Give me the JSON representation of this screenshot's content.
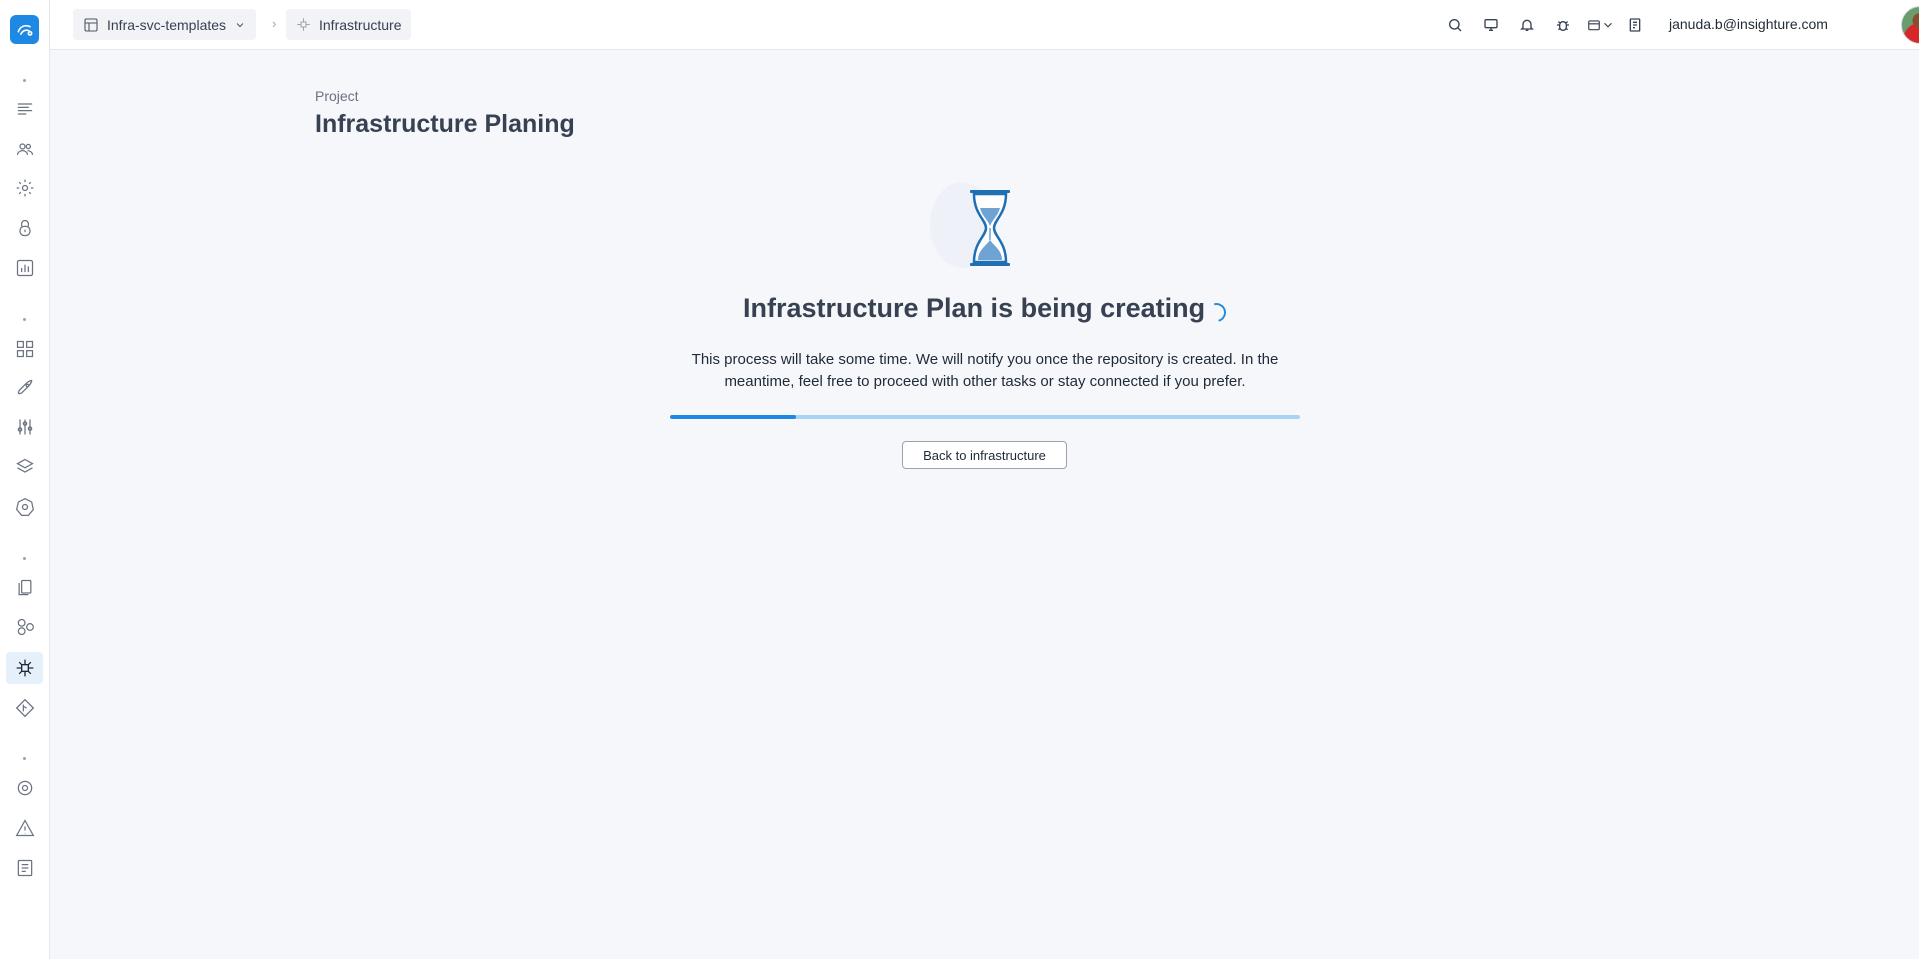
{
  "header": {
    "workspace": "Infra-svc-templates",
    "section": "Infrastructure",
    "user_email": "januda.b@insighture.com"
  },
  "sidebar": {
    "icons": [
      "menu-lines-icon",
      "users-icon",
      "gear-icon",
      "lock-icon",
      "bar-chart-icon",
      "dashboard-grid-icon",
      "rocket-icon",
      "sliders-icon",
      "layers-icon",
      "kubernetes-icon",
      "documents-icon",
      "circles-icon",
      "infrastructure-icon",
      "git-icon",
      "settings-cog-icon",
      "warning-icon",
      "notes-icon"
    ],
    "active": "infrastructure-icon"
  },
  "page": {
    "label": "Project",
    "title": "Infrastructure Planing"
  },
  "status": {
    "title": "Infrastructure Plan is being creating",
    "description": "This process will take some time. We will notify you once the repository is created. In the meantime, feel free to proceed with other tasks or stay connected if you prefer.",
    "progress": 0.2,
    "back_label": "Back to infrastructure"
  },
  "colors": {
    "accent": "#1e88e5",
    "progress_track": "#a9d3f3",
    "title_text": "#374151"
  }
}
